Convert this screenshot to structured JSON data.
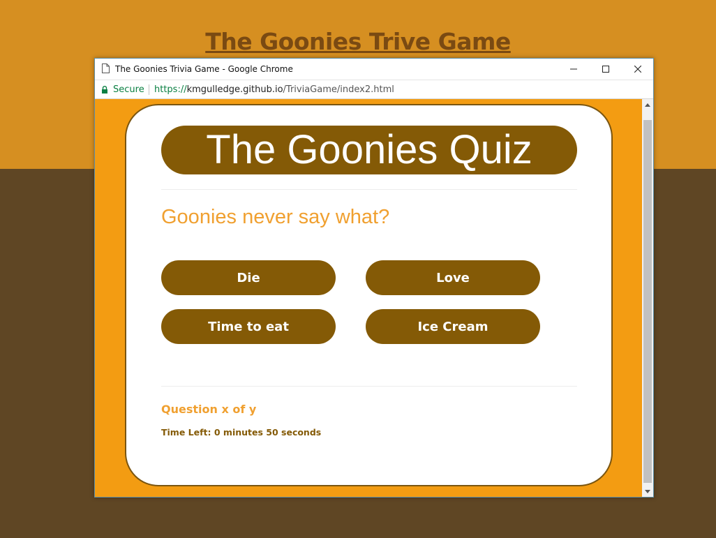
{
  "page": {
    "heading": "The Goonies Trive Game",
    "colors": {
      "top_band": "#d68f21",
      "bottom_band": "#5f4624",
      "heading": "#7a4a12"
    }
  },
  "browser": {
    "window_title": "The Goonies Trivia Game - Google Chrome",
    "secure_label": "Secure",
    "url_scheme": "https://",
    "url_host": "kmgulledge.github.io",
    "url_path": "/TriviaGame/index2.html",
    "icons": {
      "page": "page-icon",
      "lock": "lock-icon",
      "minimize": "minimize-icon",
      "maximize": "maximize-icon",
      "close": "close-icon"
    }
  },
  "quiz": {
    "title": "The Goonies Quiz",
    "question": "Goonies never say what?",
    "answers": [
      "Die",
      "Love",
      "Time to eat",
      "Ice Cream"
    ],
    "progress": "Question x of y",
    "timer": "Time Left: 0 minutes 50 seconds",
    "colors": {
      "background": "#f39c12",
      "button": "#845a06",
      "accent_text": "#f0a030"
    }
  }
}
